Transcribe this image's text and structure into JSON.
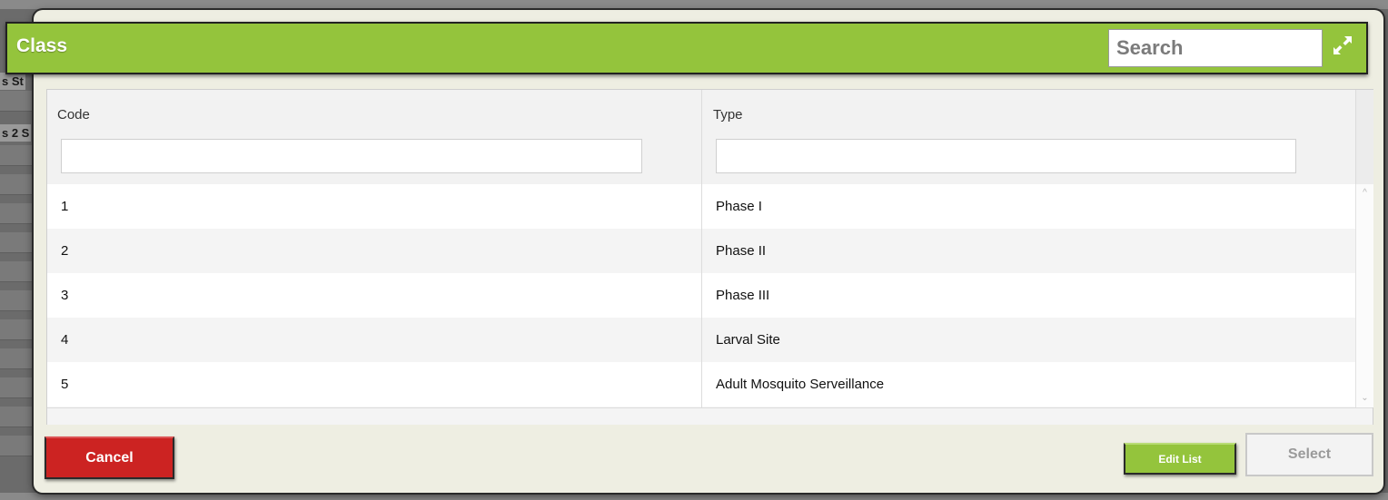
{
  "background": {
    "fragments": [
      "s St",
      "s 2 S"
    ]
  },
  "dialog": {
    "title": "Class",
    "search": {
      "placeholder": "Search",
      "value": ""
    },
    "expand_icon": "expand-arrows-icon"
  },
  "grid": {
    "columns": [
      "Code",
      "Type"
    ],
    "filters": [
      "",
      ""
    ],
    "rows": [
      {
        "code": "1",
        "type": "Phase I"
      },
      {
        "code": "2",
        "type": "Phase II"
      },
      {
        "code": "3",
        "type": "Phase III"
      },
      {
        "code": "4",
        "type": "Larval Site"
      },
      {
        "code": "5",
        "type": "Adult Mosquito Serveillance"
      }
    ]
  },
  "buttons": {
    "cancel": "Cancel",
    "edit_list": "Edit List",
    "select": "Select"
  },
  "colors": {
    "header_green": "#94c43c",
    "cancel_red": "#cc2322",
    "dialog_bg": "#eeeee2"
  }
}
